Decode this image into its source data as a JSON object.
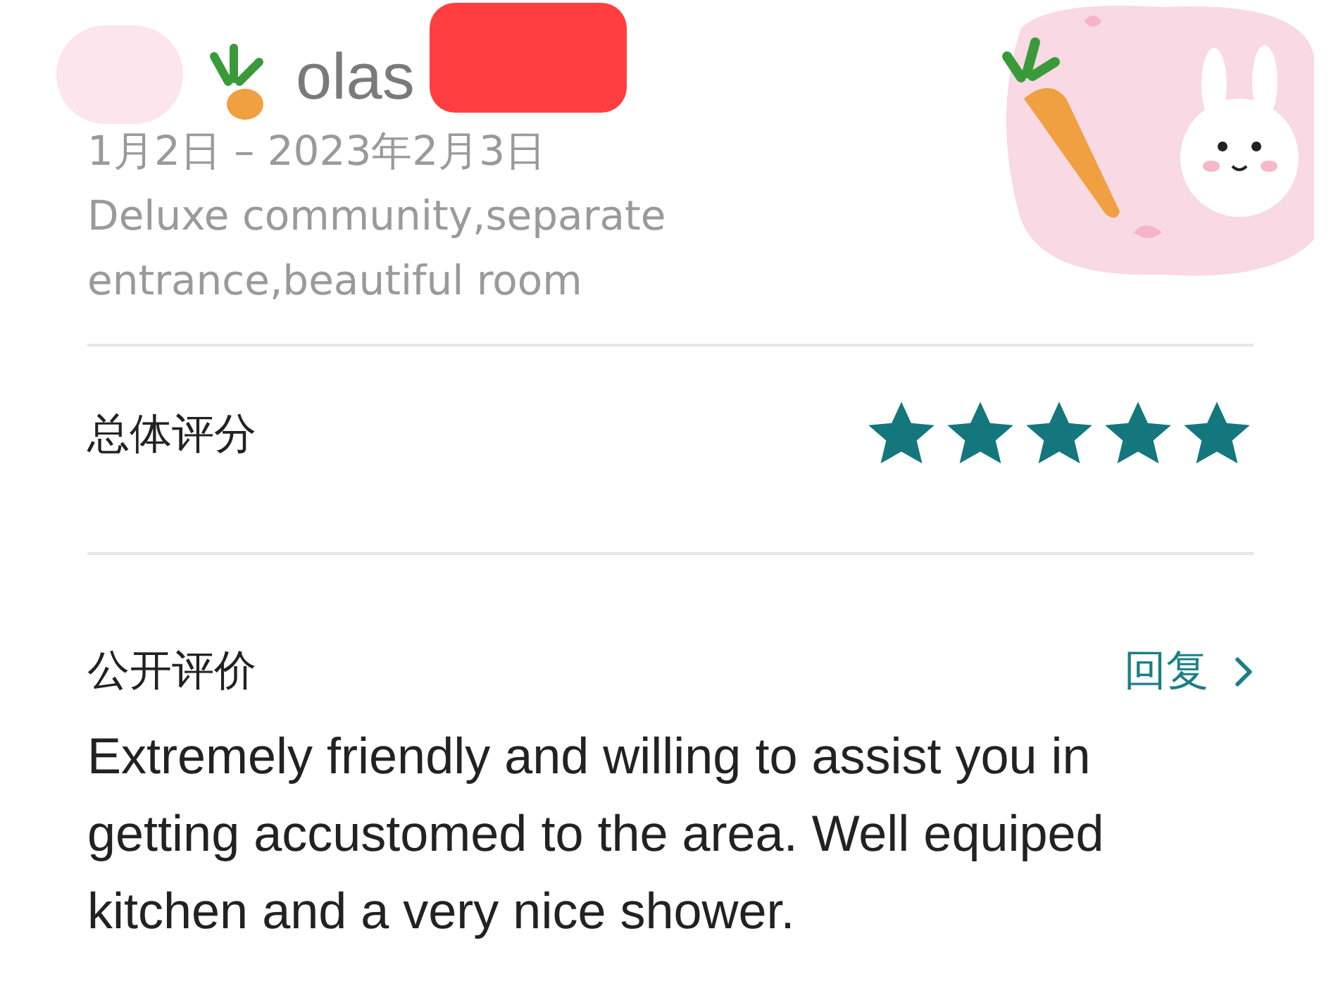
{
  "header": {
    "name_fragment": "olas",
    "dates": "1月2日 – 2023年2月3日",
    "listing": "Deluxe community,separate entrance,beautiful room"
  },
  "overall": {
    "label": "总体评分",
    "stars": 5
  },
  "public_review": {
    "label": "公开评价",
    "reply": "回复",
    "text": "Extremely friendly and willing to assist you in getting accustomed to the area. Well equiped kitchen and a very nice shower."
  }
}
